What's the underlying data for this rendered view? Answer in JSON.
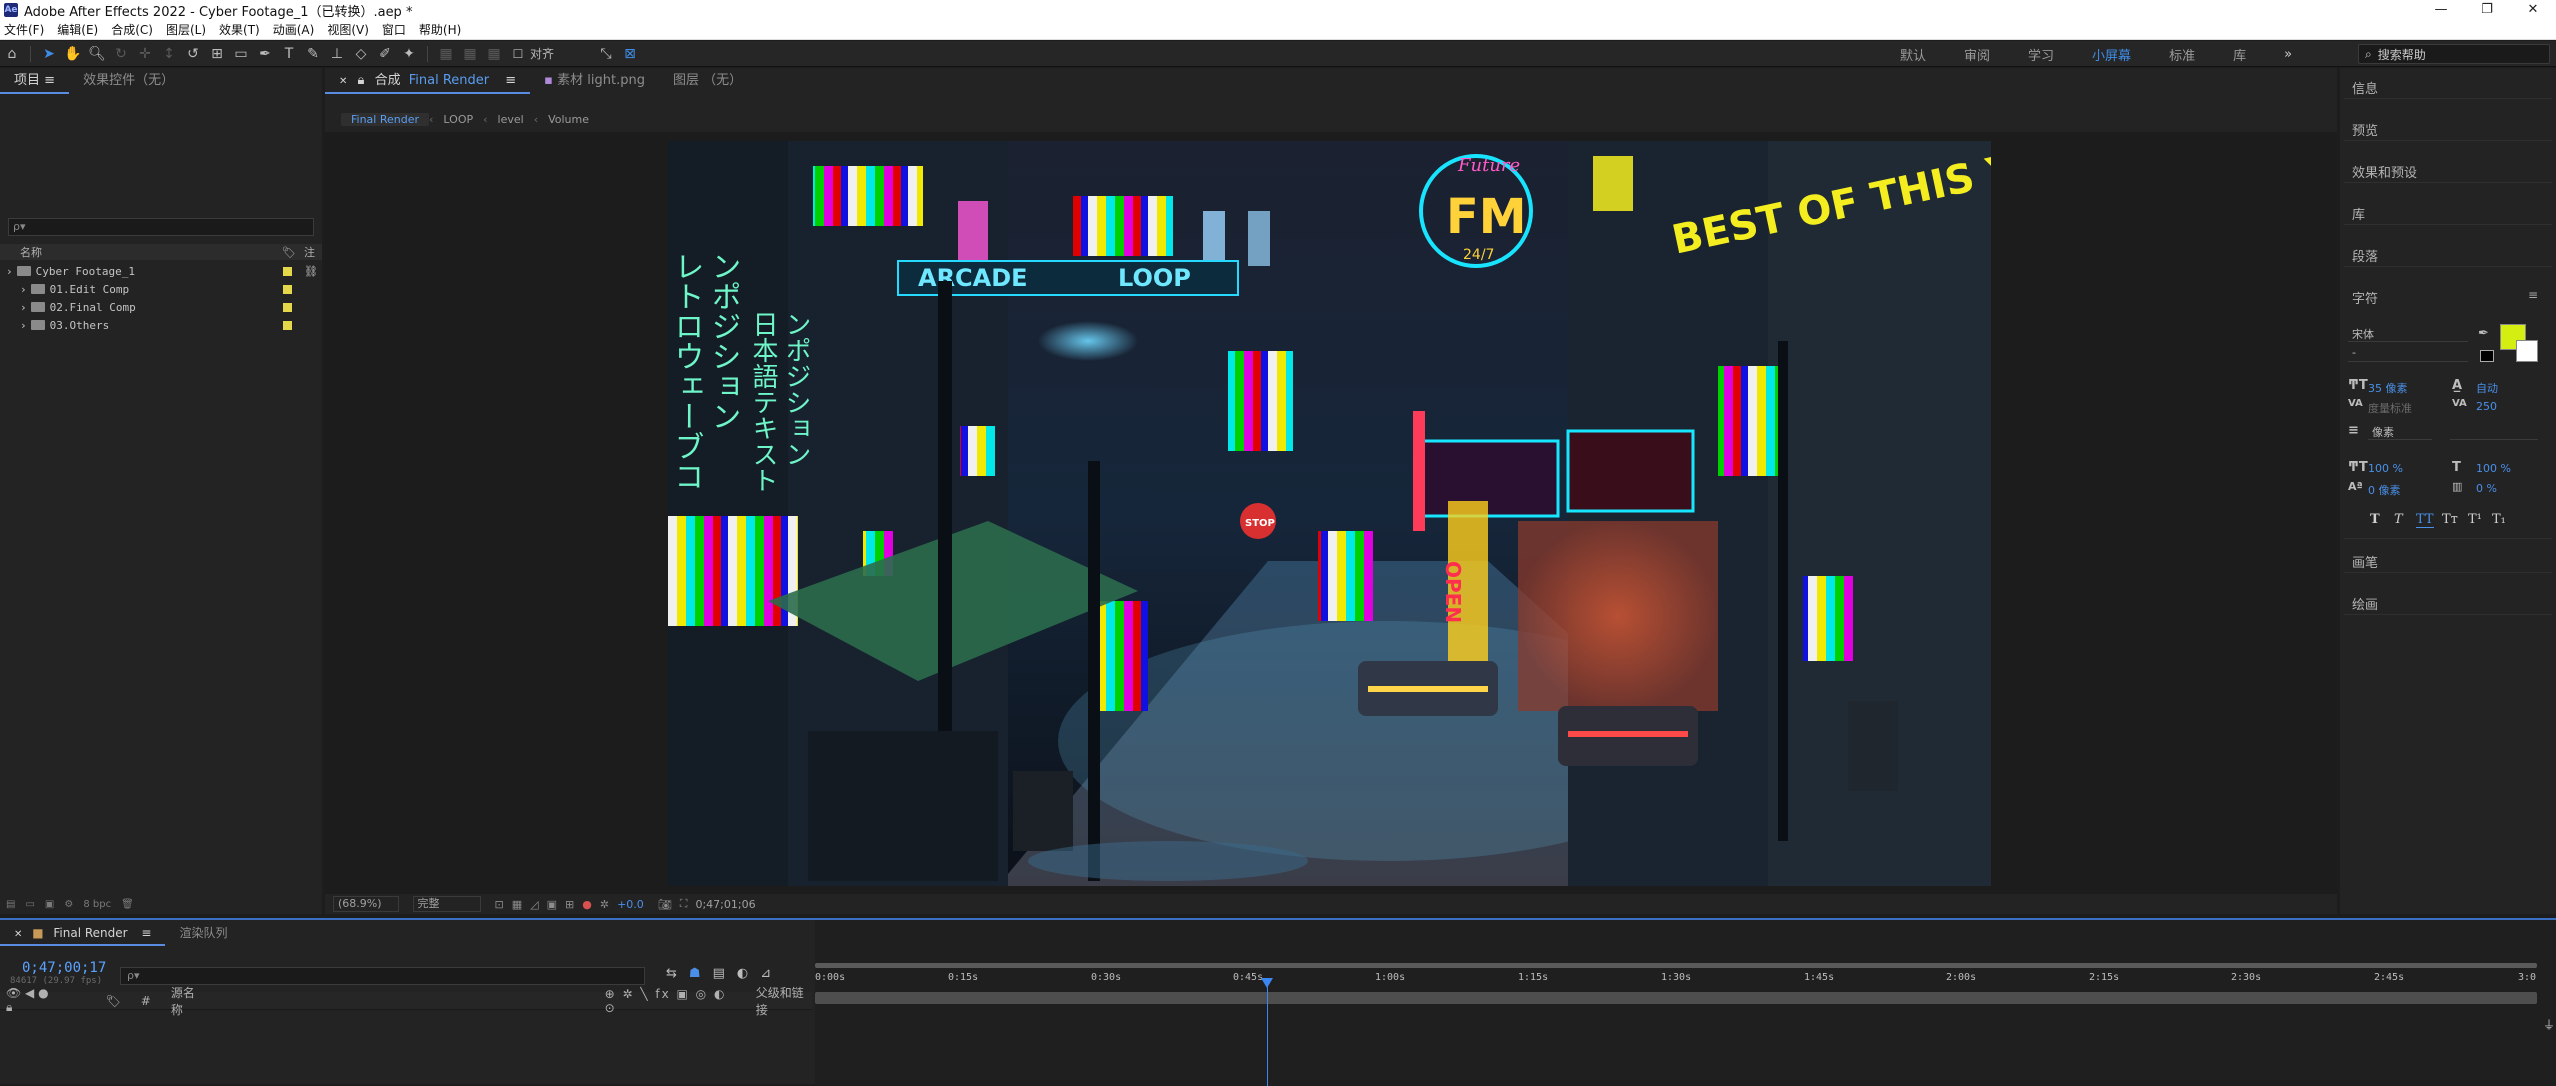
{
  "window": {
    "title": "Adobe After Effects 2022 - Cyber Footage_1（已转换）.aep *",
    "app_icon": "Ae",
    "controls": [
      "—",
      "❐",
      "✕"
    ]
  },
  "menu": [
    "文件(F)",
    "编辑(E)",
    "合成(C)",
    "图层(L)",
    "效果(T)",
    "动画(A)",
    "视图(V)",
    "窗口",
    "帮助(H)"
  ],
  "toolbar": {
    "align_label": "对齐",
    "workspaces": [
      "默认",
      "审阅",
      "学习",
      "小屏幕",
      "标准",
      "库"
    ],
    "active_workspace": "小屏幕",
    "overflow": "»",
    "search_help": "搜索帮助"
  },
  "project_panel": {
    "tabs": [
      "项目",
      "效果控件（无）"
    ],
    "search_placeholder": "ρ▾",
    "columns": {
      "name": "名称"
    },
    "items": [
      {
        "name": "Cyber Footage_1",
        "type": "comp"
      },
      {
        "name": "01.Edit Comp",
        "type": "folder"
      },
      {
        "name": "02.Final Comp",
        "type": "folder"
      },
      {
        "name": "03.Others",
        "type": "folder"
      }
    ],
    "footer": {
      "bpc": "8 bpc"
    }
  },
  "comp_panel": {
    "tabs": [
      {
        "prefix": "合成",
        "name": "Final Render"
      },
      {
        "prefix": "素材",
        "name": "light.png"
      },
      {
        "prefix": "图层",
        "name": "（无）"
      }
    ],
    "breadcrumb": [
      "Final Render",
      "LOOP",
      "level",
      "Volume"
    ],
    "footer": {
      "zoom": "(68.9%)",
      "resolution": "完整",
      "exposure": "+0.0",
      "timecode": "0;47;01;06"
    }
  },
  "frame_signs": {
    "arcade": "ARCADE",
    "loop": "LOOP",
    "best": "BEST OF THIS YEA",
    "fm": "FM",
    "fm_sub": "24/7",
    "future": "Future",
    "jp_left": "レトロウェーブコ",
    "jp_mid": "ンポジション",
    "jp_right1": "日本語テキスト",
    "jp_right2": "ンポジション",
    "open": "OPEN",
    "stop": "STOP"
  },
  "right_panel": {
    "sections": [
      "信息",
      "预览",
      "效果和预设",
      "库",
      "段落",
      "字符",
      "画笔",
      "绘画"
    ],
    "character": {
      "font": "宋体",
      "style": "-",
      "size": "35 像素",
      "leading": "自动",
      "kerning": "度量标准",
      "tracking": "250",
      "stroke": "像素",
      "vscale": "100 %",
      "hscale": "100 %",
      "baseline": "0 像素",
      "tsume": "0 %",
      "fill_color": "#d4ee12",
      "styles": [
        "T",
        "T",
        "TT",
        "Tт",
        "T¹",
        "T₁"
      ]
    }
  },
  "timeline": {
    "tabs": [
      "Final Render",
      "渲染队列"
    ],
    "current_time": "0;47;00;17",
    "frames": "84617 (29.97 fps)",
    "search_placeholder": "ρ▾",
    "header": {
      "source": "源名称",
      "parent": "父级和链接"
    },
    "ruler": [
      "0:00s",
      "0:15s",
      "0:30s",
      "0:45s",
      "1:00s",
      "1:15s",
      "1:30s",
      "1:45s",
      "2:00s",
      "2:15s",
      "2:30s",
      "2:45s",
      "3:0"
    ]
  },
  "colors": {
    "accent": "#3f8ce6",
    "label_yellow": "#e4d84a",
    "panel": "#232323"
  }
}
